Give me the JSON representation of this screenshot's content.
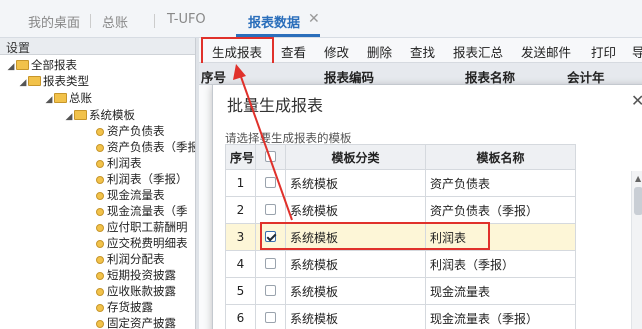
{
  "tabs": [
    {
      "label": "我的桌面"
    },
    {
      "label": "总账"
    },
    {
      "label": "T-UFO"
    },
    {
      "label": "报表数据"
    }
  ],
  "left_panel": {
    "header": "设置",
    "tree": [
      {
        "label": "全部报表"
      },
      {
        "label": "报表类型"
      },
      {
        "label": "总账"
      },
      {
        "label": "系统模板"
      },
      {
        "label": "资产负债表"
      },
      {
        "label": "资产负债表（季报"
      },
      {
        "label": "利润表"
      },
      {
        "label": "利润表（季报）"
      },
      {
        "label": "现金流量表"
      },
      {
        "label": "现金流量表（季"
      },
      {
        "label": "应付职工薪酬明"
      },
      {
        "label": "应交税费明细表"
      },
      {
        "label": "利润分配表"
      },
      {
        "label": "短期投资披露"
      },
      {
        "label": "应收账款披露"
      },
      {
        "label": "存货披露"
      },
      {
        "label": "固定资产披露"
      }
    ]
  },
  "toolbar": {
    "buttons": [
      {
        "label": "生成报表"
      },
      {
        "label": "查看"
      },
      {
        "label": "修改"
      },
      {
        "label": "删除"
      },
      {
        "label": "查找"
      },
      {
        "label": "报表汇总"
      },
      {
        "label": "发送邮件"
      },
      {
        "label": "打印"
      },
      {
        "label": "导"
      }
    ]
  },
  "background_table": {
    "columns": [
      "序号",
      "报表编码",
      "报表名称",
      "会计年"
    ]
  },
  "dialog": {
    "title": "批量生成报表",
    "prompt": "请选择要生成报表的模板",
    "columns": [
      "序号",
      "",
      "模板分类",
      "模板名称"
    ],
    "rows": [
      {
        "index": "1",
        "checked": false,
        "category": "系统模板",
        "name": "资产负债表"
      },
      {
        "index": "2",
        "checked": false,
        "category": "系统模板",
        "name": "资产负债表（季报）"
      },
      {
        "index": "3",
        "checked": true,
        "category": "系统模板",
        "name": "利润表"
      },
      {
        "index": "4",
        "checked": false,
        "category": "系统模板",
        "name": "利润表（季报）"
      },
      {
        "index": "5",
        "checked": false,
        "category": "系统模板",
        "name": "现金流量表"
      },
      {
        "index": "6",
        "checked": false,
        "category": "系统模板",
        "name": "现金流量表（季报）"
      }
    ]
  },
  "colors": {
    "accent": "#2a6ebb",
    "annotation": "#e0312b",
    "selected_row": "#fdf6d7",
    "folder": "#f2c24a"
  }
}
